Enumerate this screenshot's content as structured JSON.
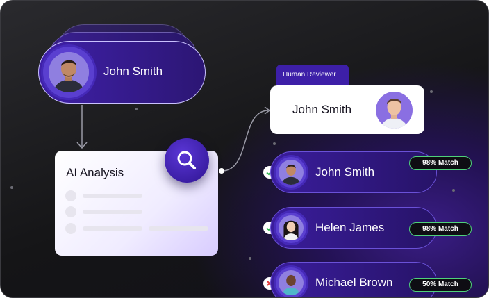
{
  "user": {
    "name": "John Smith",
    "avatar_icon": "person-avatar"
  },
  "ai_card": {
    "title": "AI Analysis",
    "action_icon": "search-icon"
  },
  "reviewer": {
    "tab_label": "Human Reviewer",
    "name": "John Smith",
    "avatar_icon": "person-avatar"
  },
  "candidates": [
    {
      "name": "John Smith",
      "match": "98% Match",
      "status": "approved",
      "status_icon": "check-icon"
    },
    {
      "name": "Helen James",
      "match": "98% Match",
      "status": "approved",
      "status_icon": "check-icon"
    },
    {
      "name": "Michael Brown",
      "match": "50% Match",
      "status": "rejected",
      "status_icon": "close-icon"
    }
  ],
  "colors": {
    "accent": "#3d1fa8",
    "approve": "#2bb24c",
    "reject": "#e23b3b",
    "badge_border": "#4fd17a"
  }
}
